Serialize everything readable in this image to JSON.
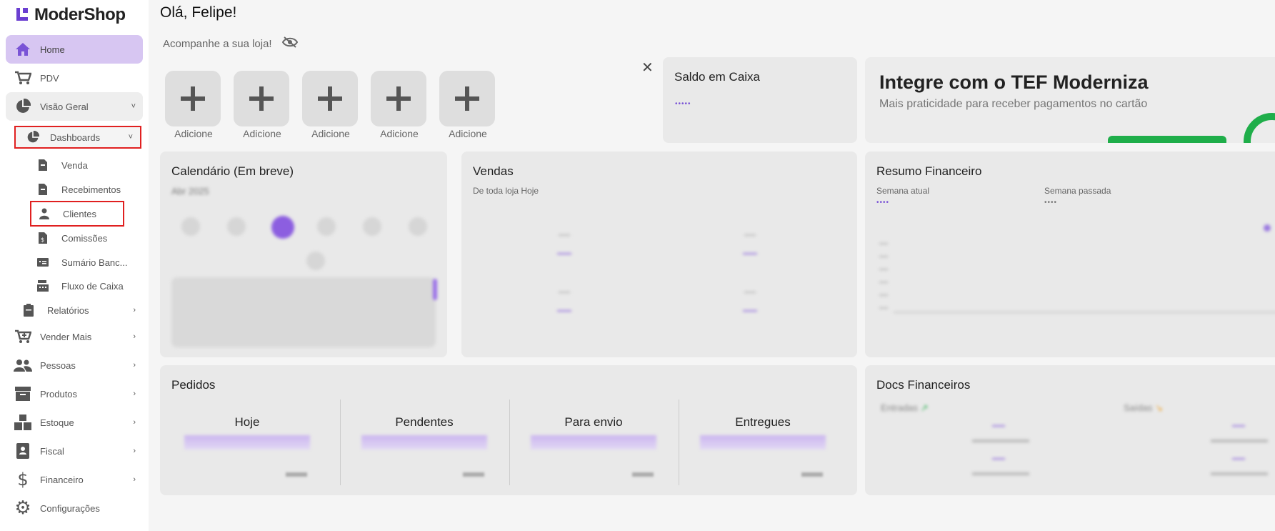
{
  "app": {
    "logo_text": "ModerShop"
  },
  "sidebar": {
    "home": "Home",
    "pdv": "PDV",
    "visao_geral": "Visão Geral",
    "dashboards": "Dashboards",
    "sub": {
      "venda": "Venda",
      "recebimentos": "Recebimentos",
      "clientes": "Clientes",
      "comissoes": "Comissões",
      "sumario": "Sumário Banc...",
      "fluxo": "Fluxo de Caixa"
    },
    "relatorios": "Relatórios",
    "vender_mais": "Vender Mais",
    "pessoas": "Pessoas",
    "produtos": "Produtos",
    "estoque": "Estoque",
    "fiscal": "Fiscal",
    "financeiro": "Financeiro",
    "configuracoes": "Configurações"
  },
  "header": {
    "greeting": "Olá, Felipe!",
    "subtitle": "Acompanhe a sua loja!"
  },
  "quick_actions": [
    "Adicione",
    "Adicione",
    "Adicione",
    "Adicione",
    "Adicione"
  ],
  "saldo": {
    "title": "Saldo em Caixa",
    "value": "•••••"
  },
  "banner": {
    "title": "Integre com o TEF Moderniza",
    "subtitle": "Mais praticidade para receber pagamentos no cartão"
  },
  "calendario": {
    "title": "Calendário (Em breve)",
    "month": "Abr 2025"
  },
  "vendas": {
    "title": "Vendas",
    "subtitle": "De toda loja Hoje"
  },
  "resumo": {
    "title": "Resumo Financeiro",
    "semana_atual": "Semana atual",
    "semana_passada": "Semana passada",
    "masked": "••••"
  },
  "pedidos": {
    "title": "Pedidos",
    "cols": [
      "Hoje",
      "Pendentes",
      "Para envio",
      "Entregues"
    ]
  },
  "docs": {
    "title": "Docs Financeiros",
    "entradas": "Entradas",
    "saidas": "Saídas"
  },
  "colors": {
    "accent": "#7a54d6",
    "home_bg": "#d7c6f2",
    "highlight": "#e02020"
  }
}
